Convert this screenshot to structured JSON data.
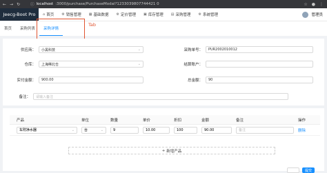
{
  "browser": {
    "url_host": "localhost",
    "url_path": ":3000/purchase/PurchaseModal?1233039807744421 0"
  },
  "app": {
    "brand": "Jeecg-Boot Pro"
  },
  "menu": [
    {
      "label": "首页",
      "icon": "home-icon"
    },
    {
      "label": "销售管理",
      "icon": "settings-icon"
    },
    {
      "label": "基础数据",
      "icon": "grid-icon"
    },
    {
      "label": "定价管理",
      "icon": "settings-icon"
    },
    {
      "label": "库存管理",
      "icon": "box-icon"
    },
    {
      "label": "采购管理",
      "icon": "cart-icon"
    },
    {
      "label": "系统管理",
      "icon": "settings-icon"
    }
  ],
  "user": {
    "name": "管理员"
  },
  "tabs": [
    {
      "label": "首页"
    },
    {
      "label": "采购列表"
    },
    {
      "label": "采购详情"
    }
  ],
  "annotation": {
    "label": "Tab"
  },
  "form": {
    "supplier_label": "供应商：",
    "supplier_value": "小黑科技",
    "order_no_label": "采购单号：",
    "order_no_value": "PUR2002010012",
    "warehouse_label": "仓库：",
    "warehouse_value": "上海稀北仓",
    "settle_label": "结算账户：",
    "settle_value": "",
    "paid_label": "实付金额：",
    "paid_value": "900.00",
    "total_label": "总金额：",
    "total_value": "90",
    "remark_label": "备注：",
    "remark_placeholder": "请输入备注"
  },
  "table": {
    "headers": [
      "产品",
      "单位",
      "数量",
      "单价",
      "折扣",
      "金额",
      "备注",
      "操作"
    ],
    "rows": [
      {
        "product": "车附净水器",
        "unit": "台",
        "qty": "9",
        "price": "10.00",
        "discount": "100",
        "amount": "90.00",
        "remark": "备注",
        "action": "删除"
      }
    ],
    "add_row_label": "新增产品"
  },
  "footer": {
    "confirm_label": "提交"
  }
}
